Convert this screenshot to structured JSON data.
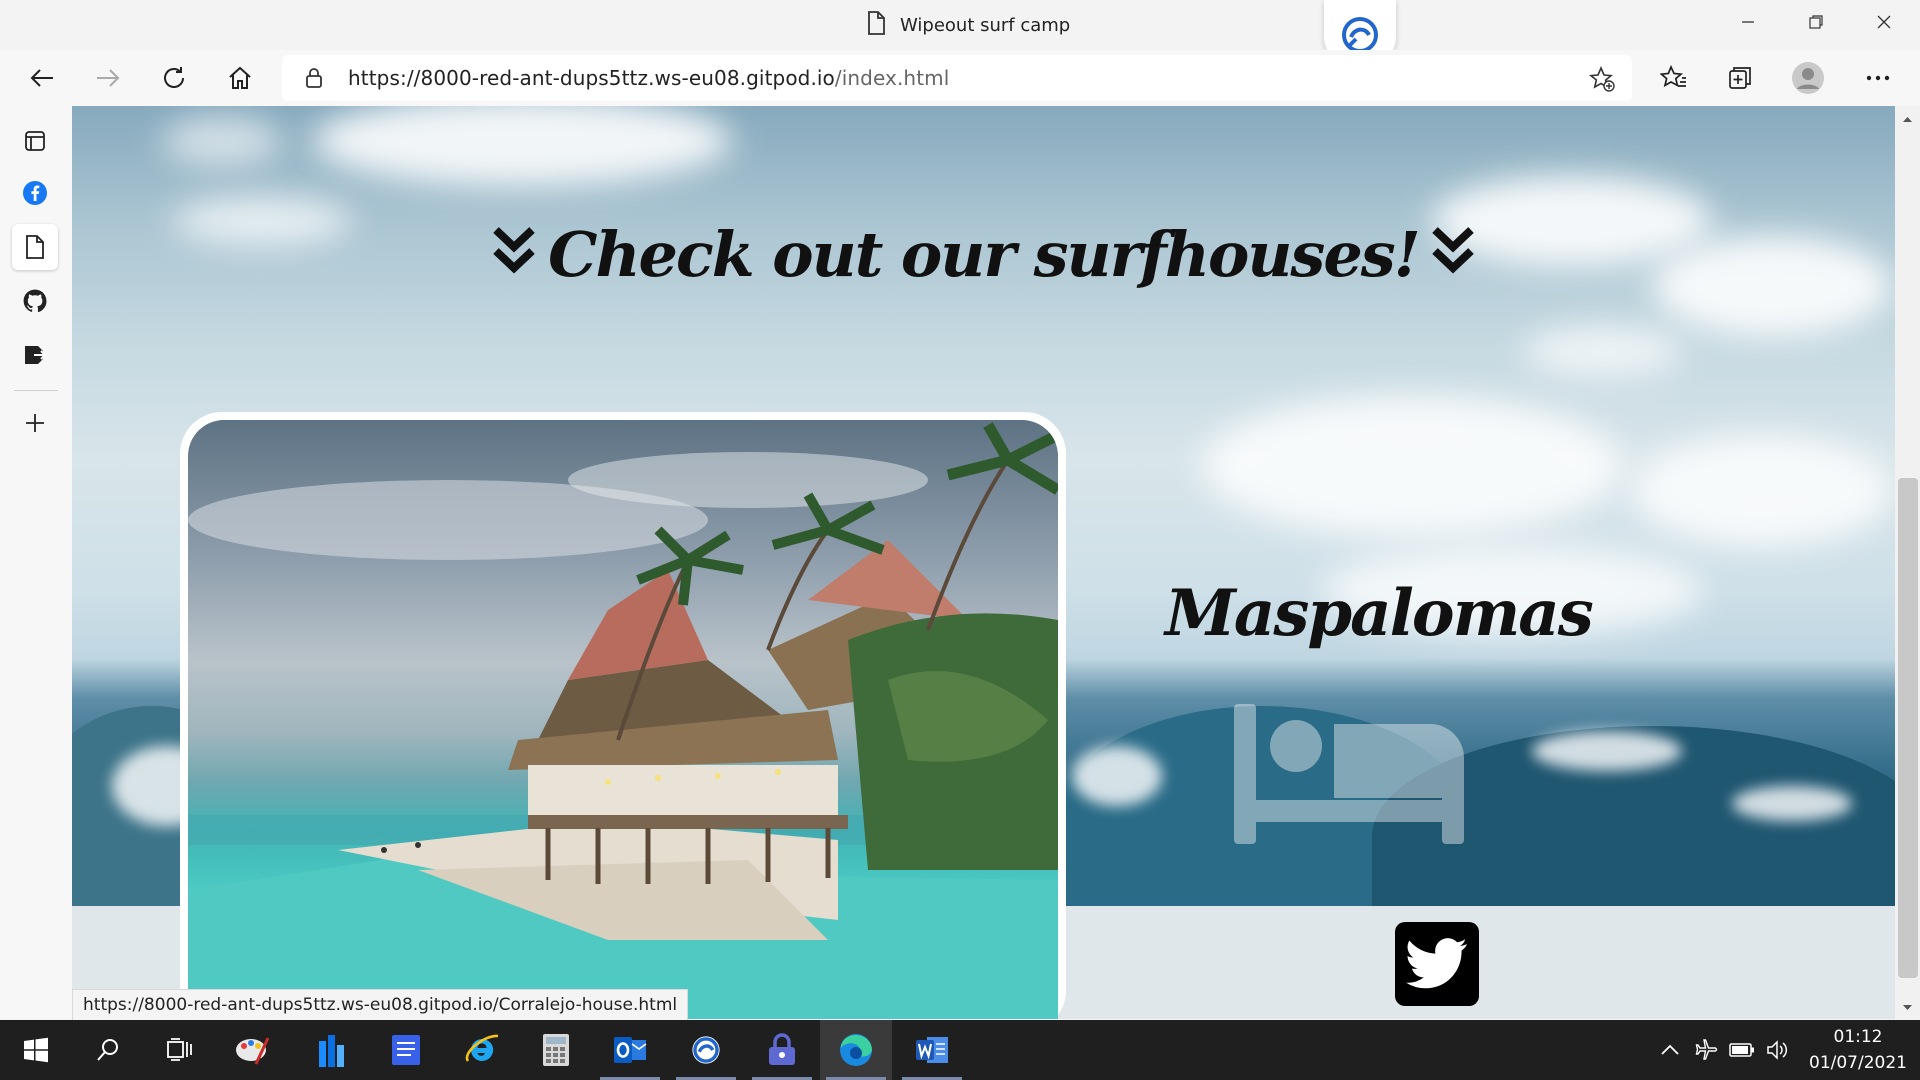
{
  "browser": {
    "tab_title": "Wipeout surf camp",
    "url_main": "https://8000-red-ant-dups5ttz.ws-eu08.gitpod.io",
    "url_path": "/index.html",
    "status_link": "https://8000-red-ant-dups5ttz.ws-eu08.gitpod.io/Corralejo-house.html"
  },
  "page": {
    "section_heading": "Check out our surfhouses!",
    "house_name": "Maspalomas"
  },
  "taskbar": {
    "time": "01:12",
    "date": "01/07/2021"
  },
  "colors": {
    "browser_chrome": "#f3f3f3",
    "taskbar": "#1f1f1f",
    "footer_band": "#dfe7eb",
    "twitter_bg": "#000000"
  }
}
